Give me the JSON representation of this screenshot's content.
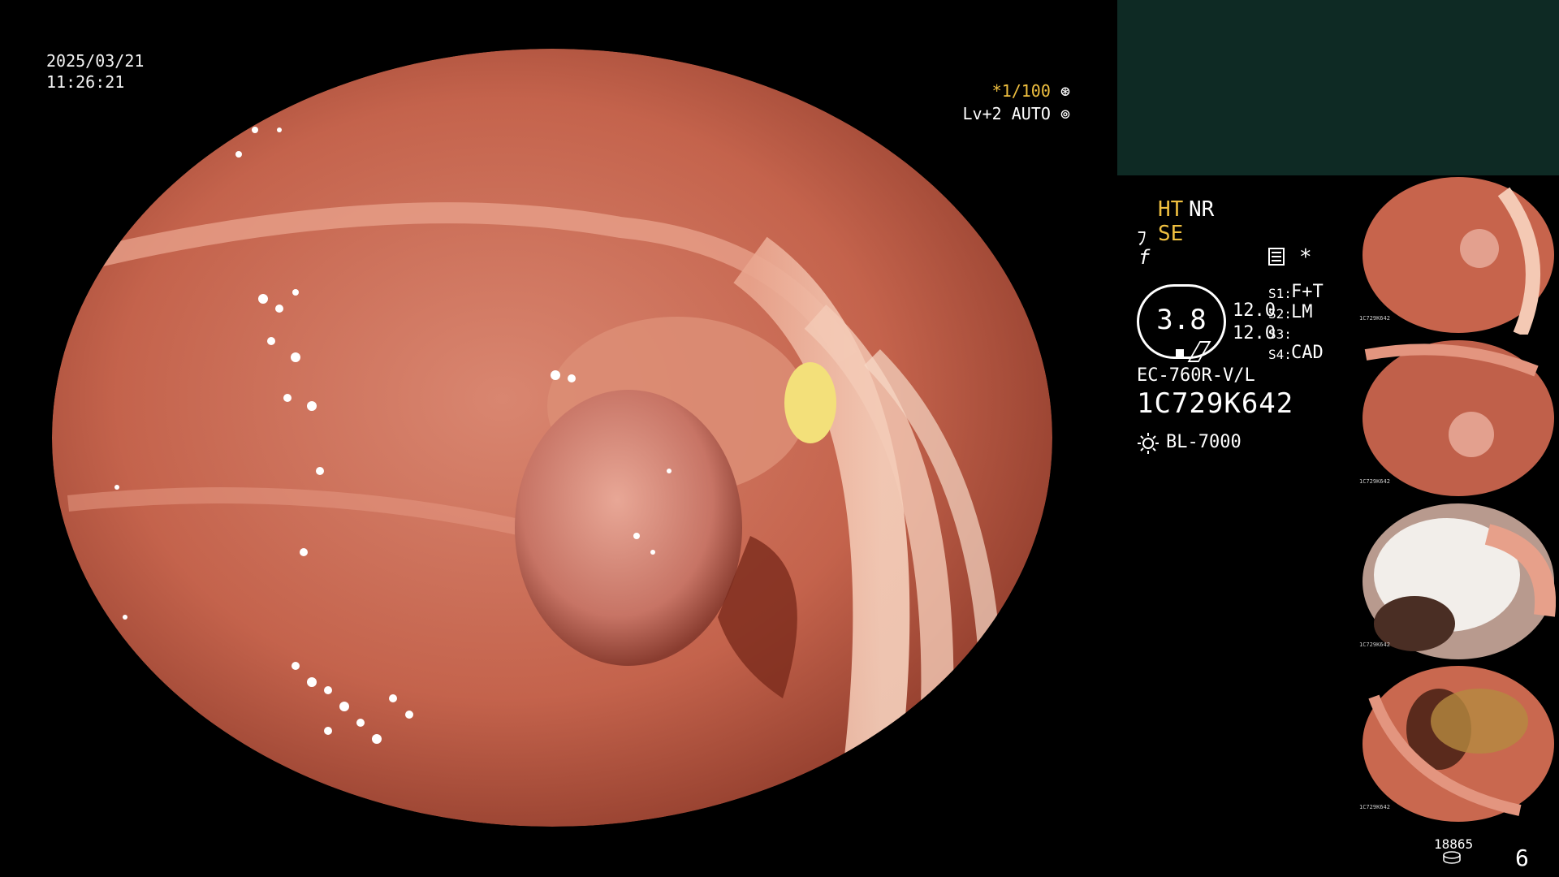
{
  "overlay": {
    "date": "2025/03/21",
    "time": "11:26:21",
    "zoom_prefix": "*",
    "zoom": "1/100",
    "level": "Lv+2",
    "mode": "AUTO"
  },
  "panel": {
    "ht": "HT",
    "nr": "NR",
    "se": "SE",
    "f_symbol": "f",
    "center_value": "3.8",
    "value_top": "12.0",
    "value_bottom": "12.0",
    "asterisk": "*",
    "s1_label": "S1:",
    "s1_value": "F+T",
    "s2_label": "S2:",
    "s2_value": "LM",
    "s3_label": "S3:",
    "s3_value": "",
    "s4_label": "S4:",
    "s4_value": "CAD",
    "scope_model": "EC-760R-V/L",
    "scope_serial": "1C729K642",
    "light_source": "BL-7000",
    "image_count_label": "18865",
    "page_number": "6"
  },
  "thumbnails": [
    {
      "caption": "1C729K642"
    },
    {
      "caption": "1C729K642"
    },
    {
      "caption": "1C729K642"
    },
    {
      "caption": "1C729K642"
    }
  ],
  "colors": {
    "accent_yellow": "#f0c040",
    "panel_top": "#0e2a24",
    "mucosa": "#c96a52"
  },
  "icons": [
    "aperture-icon",
    "iris-icon",
    "scope-icon",
    "menu-icon",
    "sun-icon",
    "disk-icon"
  ]
}
